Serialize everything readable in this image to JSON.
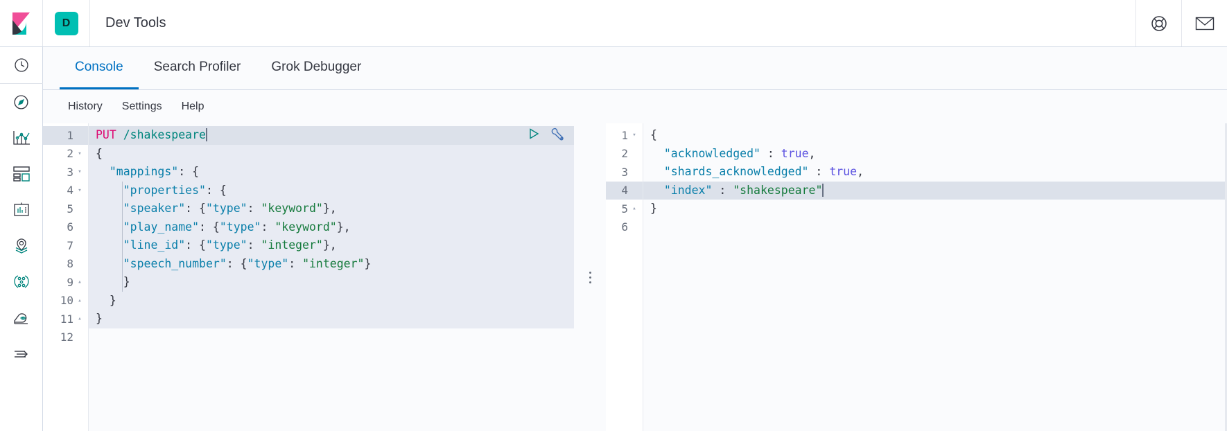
{
  "header": {
    "logo_icon": "kibana-logo",
    "app_badge_letter": "D",
    "title": "Dev Tools",
    "help_icon": "life-ring-help-icon",
    "mail_icon": "mail-envelope-icon"
  },
  "nav_rail": {
    "items": [
      {
        "name": "recently-viewed",
        "icon": "clock-icon"
      },
      {
        "name": "discover",
        "icon": "compass-icon"
      },
      {
        "name": "visualize",
        "icon": "bar-chart-icon"
      },
      {
        "name": "dashboard",
        "icon": "dashboard-grid-icon"
      },
      {
        "name": "canvas",
        "icon": "canvas-presentation-icon"
      },
      {
        "name": "maps",
        "icon": "map-marker-layers-icon"
      },
      {
        "name": "graph",
        "icon": "graph-nodes-icon"
      },
      {
        "name": "machine-learning",
        "icon": "machine-learning-icon"
      },
      {
        "name": "collapse-nav",
        "icon": "arrow-right-collapse-icon"
      }
    ]
  },
  "tabs": [
    {
      "label": "Console",
      "active": true
    },
    {
      "label": "Search Profiler",
      "active": false
    },
    {
      "label": "Grok Debugger",
      "active": false
    }
  ],
  "menu": [
    {
      "label": "History"
    },
    {
      "label": "Settings"
    },
    {
      "label": "Help"
    }
  ],
  "editor": {
    "actions": {
      "play_icon": "play-run-request-icon",
      "wrench_icon": "wrench-options-icon"
    },
    "lines": [
      {
        "n": "1",
        "fold": "",
        "highlight": true,
        "indent": 0,
        "tokens": [
          {
            "t": "method",
            "v": "PUT"
          },
          {
            "t": "punct",
            "v": " "
          },
          {
            "t": "url",
            "v": "/shakespeare"
          },
          {
            "t": "caret",
            "v": ""
          }
        ]
      },
      {
        "n": "2",
        "fold": "down",
        "highlight": false,
        "indent": 0,
        "tokens": [
          {
            "t": "punct",
            "v": "{"
          }
        ]
      },
      {
        "n": "3",
        "fold": "down",
        "highlight": false,
        "indent": 0,
        "tokens": [
          {
            "t": "punct",
            "v": "  "
          },
          {
            "t": "key",
            "v": "\"mappings\""
          },
          {
            "t": "punct",
            "v": ": {"
          }
        ]
      },
      {
        "n": "4",
        "fold": "down",
        "highlight": false,
        "indent": 1,
        "tokens": [
          {
            "t": "punct",
            "v": "    "
          },
          {
            "t": "key",
            "v": "\"properties\""
          },
          {
            "t": "punct",
            "v": ": {"
          }
        ]
      },
      {
        "n": "5",
        "fold": "",
        "highlight": false,
        "indent": 1,
        "tokens": [
          {
            "t": "punct",
            "v": "    "
          },
          {
            "t": "key",
            "v": "\"speaker\""
          },
          {
            "t": "punct",
            "v": ": {"
          },
          {
            "t": "key",
            "v": "\"type\""
          },
          {
            "t": "punct",
            "v": ": "
          },
          {
            "t": "str",
            "v": "\"keyword\""
          },
          {
            "t": "punct",
            "v": "},"
          }
        ]
      },
      {
        "n": "6",
        "fold": "",
        "highlight": false,
        "indent": 1,
        "tokens": [
          {
            "t": "punct",
            "v": "    "
          },
          {
            "t": "key",
            "v": "\"play_name\""
          },
          {
            "t": "punct",
            "v": ": {"
          },
          {
            "t": "key",
            "v": "\"type\""
          },
          {
            "t": "punct",
            "v": ": "
          },
          {
            "t": "str",
            "v": "\"keyword\""
          },
          {
            "t": "punct",
            "v": "},"
          }
        ]
      },
      {
        "n": "7",
        "fold": "",
        "highlight": false,
        "indent": 1,
        "tokens": [
          {
            "t": "punct",
            "v": "    "
          },
          {
            "t": "key",
            "v": "\"line_id\""
          },
          {
            "t": "punct",
            "v": ": {"
          },
          {
            "t": "key",
            "v": "\"type\""
          },
          {
            "t": "punct",
            "v": ": "
          },
          {
            "t": "str",
            "v": "\"integer\""
          },
          {
            "t": "punct",
            "v": "},"
          }
        ]
      },
      {
        "n": "8",
        "fold": "",
        "highlight": false,
        "indent": 1,
        "tokens": [
          {
            "t": "punct",
            "v": "    "
          },
          {
            "t": "key",
            "v": "\"speech_number\""
          },
          {
            "t": "punct",
            "v": ": {"
          },
          {
            "t": "key",
            "v": "\"type\""
          },
          {
            "t": "punct",
            "v": ": "
          },
          {
            "t": "str",
            "v": "\"integer\""
          },
          {
            "t": "punct",
            "v": "}"
          }
        ]
      },
      {
        "n": "9",
        "fold": "up",
        "highlight": false,
        "indent": 1,
        "tokens": [
          {
            "t": "punct",
            "v": "    }"
          }
        ]
      },
      {
        "n": "10",
        "fold": "up",
        "highlight": false,
        "indent": 0,
        "tokens": [
          {
            "t": "punct",
            "v": "  }"
          }
        ]
      },
      {
        "n": "11",
        "fold": "up",
        "highlight": false,
        "indent": 0,
        "tokens": [
          {
            "t": "punct",
            "v": "}"
          }
        ]
      },
      {
        "n": "12",
        "fold": "",
        "highlight": false,
        "indent": -1,
        "empty": true,
        "tokens": []
      }
    ]
  },
  "response": {
    "lines": [
      {
        "n": "1",
        "fold": "down",
        "highlight": false,
        "tokens": [
          {
            "t": "punct",
            "v": "{"
          }
        ]
      },
      {
        "n": "2",
        "fold": "",
        "highlight": false,
        "tokens": [
          {
            "t": "punct",
            "v": "  "
          },
          {
            "t": "key",
            "v": "\"acknowledged\""
          },
          {
            "t": "punct",
            "v": " : "
          },
          {
            "t": "bool",
            "v": "true"
          },
          {
            "t": "punct",
            "v": ","
          }
        ]
      },
      {
        "n": "3",
        "fold": "",
        "highlight": false,
        "tokens": [
          {
            "t": "punct",
            "v": "  "
          },
          {
            "t": "key",
            "v": "\"shards_acknowledged\""
          },
          {
            "t": "punct",
            "v": " : "
          },
          {
            "t": "bool",
            "v": "true"
          },
          {
            "t": "punct",
            "v": ","
          }
        ]
      },
      {
        "n": "4",
        "fold": "",
        "highlight": true,
        "tokens": [
          {
            "t": "punct",
            "v": "  "
          },
          {
            "t": "key",
            "v": "\"index\""
          },
          {
            "t": "punct",
            "v": " : "
          },
          {
            "t": "str",
            "v": "\"shakespeare\""
          },
          {
            "t": "caret",
            "v": ""
          }
        ]
      },
      {
        "n": "5",
        "fold": "up",
        "highlight": false,
        "tokens": [
          {
            "t": "punct",
            "v": "}"
          }
        ]
      },
      {
        "n": "6",
        "fold": "",
        "highlight": false,
        "empty": true,
        "tokens": []
      }
    ]
  },
  "splitter": {
    "name": "panel-resize-handle",
    "dots": 3
  },
  "colors": {
    "accent_blue": "#0071c2",
    "teal": "#00bfb3",
    "pink": "#f04e98",
    "method": "#dd0a73",
    "url": "#00857d",
    "key": "#0a7faa",
    "string": "#157a3c",
    "boolean": "#5a50e0",
    "highlight_row": "#dce1ea",
    "editor_bg": "#e8ebf3"
  }
}
